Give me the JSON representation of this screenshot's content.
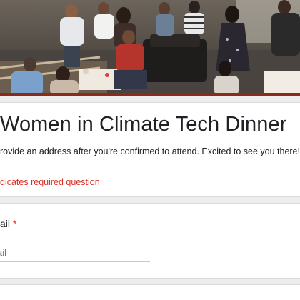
{
  "header": {
    "image": "group-dinner-photo"
  },
  "form": {
    "title": "Women in Climate Tech Dinner",
    "description": "rovide an address after you're confirmed to attend. Excited to see you there!",
    "required_note": "dicates required question"
  },
  "question": {
    "label": "ail",
    "required_mark": "*",
    "placeholder": "r email",
    "value": ""
  },
  "colors": {
    "accent": "#8c2a1c",
    "required": "#d93025",
    "page_bg": "#ededed"
  }
}
